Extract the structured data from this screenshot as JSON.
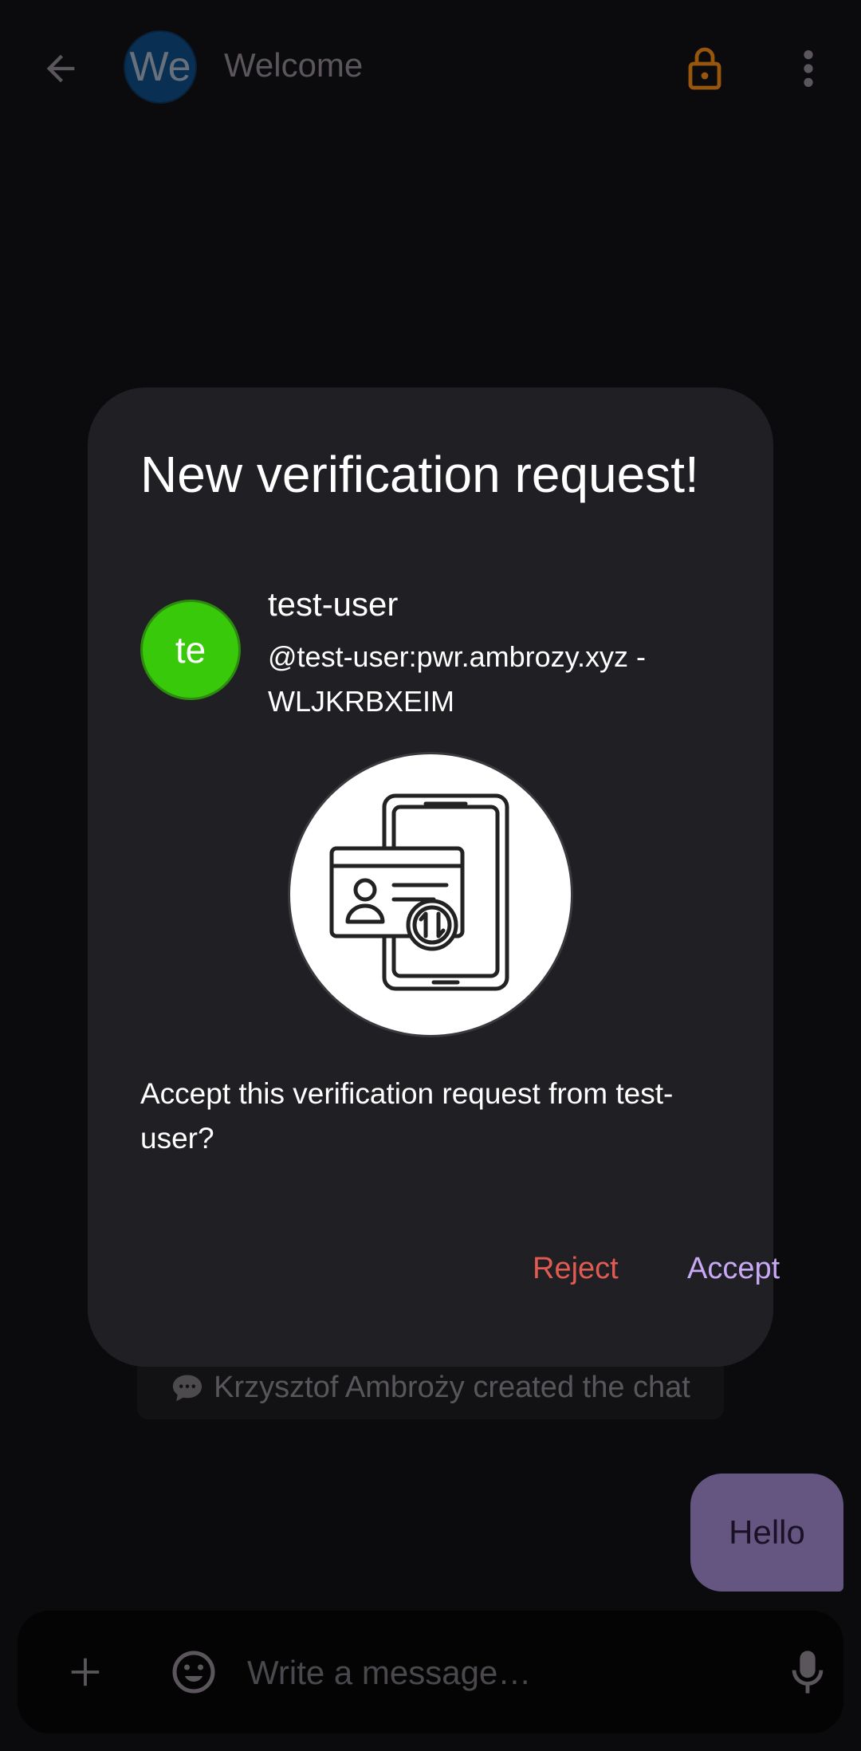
{
  "app_bar": {
    "room_avatar_initials": "We",
    "room_title": "Welcome",
    "icons": {
      "back": "arrow-back-icon",
      "encryption": "lock-open-icon",
      "more": "more-vert-icon"
    },
    "colors": {
      "avatar_bg": "#0c3b66",
      "lock": "#b86a10"
    }
  },
  "timeline": {
    "system_message": "Krzysztof Ambroży created the chat",
    "system_message_icon": "speech-bubble-icon",
    "messages": [
      {
        "text": "Hello",
        "own": true
      }
    ],
    "colors": {
      "own_bubble": "#7a6a9d"
    }
  },
  "composer": {
    "placeholder": "Write a message…",
    "icons": {
      "add": "plus-icon",
      "emoji": "emoji-icon",
      "mic": "mic-icon"
    }
  },
  "dialog": {
    "title": "New verification request!",
    "user": {
      "avatar_initials": "te",
      "display_name": "test-user",
      "id_line": "@test-user:pwr.ambrozy.xyz - WLJKRBXEIM",
      "avatar_color": "#38c90a"
    },
    "illustration_icon": "phone-id-card-verification-icon",
    "body": "Accept this verification request from test-user?",
    "reject_label": "Reject",
    "accept_label": "Accept",
    "colors": {
      "surface": "#201f23",
      "reject": "#e25b52",
      "accept": "#c8a9f5"
    }
  }
}
